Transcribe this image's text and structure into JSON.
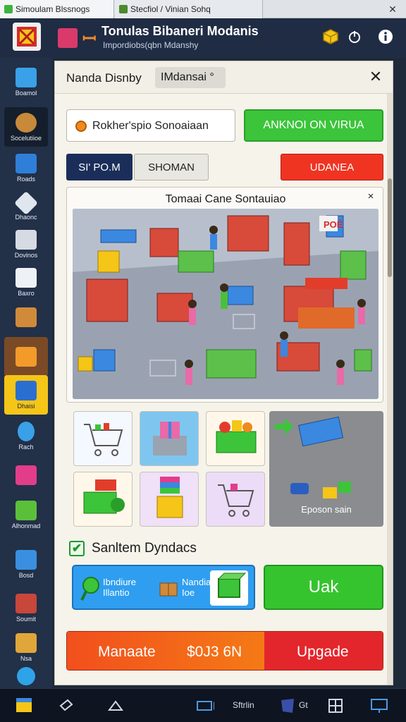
{
  "browser": {
    "tabs": [
      {
        "label": "Simoulam Blssnogs",
        "favicon_color": "#3cb43c"
      },
      {
        "label": "Stecfiol / Vinian Sohq",
        "favicon_color": "#4a8a2c"
      }
    ],
    "close_glyph": "✕"
  },
  "app": {
    "title": "Tonulas Bibaneri Modanis",
    "subtitle": "Impordiobs(qbn Mdanshy",
    "header_icons": [
      {
        "name": "cube-icon",
        "color": "#f5c518"
      },
      {
        "name": "power-icon",
        "color": "#ffffff"
      },
      {
        "name": "info-icon",
        "color": "#ffffff"
      }
    ]
  },
  "sidebar": {
    "items": [
      {
        "label": "Boamol",
        "icon": "cube-blue-icon",
        "color": "#3aa0e8"
      },
      {
        "label": "Socelutiioe",
        "icon": "cookie-icon",
        "color": "#c8893a",
        "state": "dark"
      },
      {
        "label": "Roads",
        "icon": "window-icon",
        "color": "#2f7fd8"
      },
      {
        "label": "Dhaonc",
        "icon": "box-open-icon",
        "color": "#e0e6ee"
      },
      {
        "label": "Dovinos",
        "icon": "grid-icon",
        "color": "#d6dae2"
      },
      {
        "label": "Baxro",
        "icon": "box-white-icon",
        "color": "#eef1f5"
      },
      {
        "label": "",
        "icon": "crate-icon",
        "color": "#d08a3a"
      },
      {
        "label": "",
        "icon": "bag-icon",
        "color": "#f29a2a",
        "state": "brown"
      },
      {
        "label": "Dhaisi",
        "icon": "books-icon",
        "color": "#2a6fd0",
        "state": "active"
      },
      {
        "label": "Rach",
        "icon": "sign-icon",
        "color": "#3aa0e8"
      },
      {
        "label": "",
        "icon": "shop-pink-icon",
        "color": "#e23d8a"
      },
      {
        "label": "Alhonmad",
        "icon": "green-box-icon",
        "color": "#5cbf3a"
      },
      {
        "label": "Bosd",
        "icon": "blue-box-icon",
        "color": "#3a8fe0"
      },
      {
        "label": "Soumit",
        "icon": "storefront-icon",
        "color": "#c8463a"
      },
      {
        "label": "Nsа",
        "icon": "package-icon",
        "color": "#e0a63a"
      },
      {
        "label": "",
        "icon": "orb-icon",
        "color": "#2fa3e8"
      }
    ]
  },
  "dialog": {
    "title": "Nanda Disnby",
    "chip": "IMdansai °",
    "close_glyph": "✕",
    "search_value": "Rokher'spio Sonoaiaan",
    "green_button": "ANKNOI ON VIRUA",
    "navy_button": "SI' PO.M",
    "grey_button": "SHOMAN",
    "red_button": "UDANEA",
    "scene_title": "Tomaai Cane Sontauiao",
    "scene_close": "×",
    "scene_sign": "POÊ",
    "promo_label": "Eposon sain",
    "checkbox_label": "Sanltem Dyndacs",
    "checkbox_mark": "✔",
    "info_text_1": "Ibndiure",
    "info_text_2": "Nandia",
    "info_text_3": "Illantio",
    "info_text_4": "Ioe",
    "uak_button": "Uak",
    "update_left": "Manaate",
    "update_price": "$0J3 6N",
    "update_right": "Upgade"
  },
  "taskbar": {
    "text_1": "Sftrlin",
    "text_2": "Gt"
  }
}
